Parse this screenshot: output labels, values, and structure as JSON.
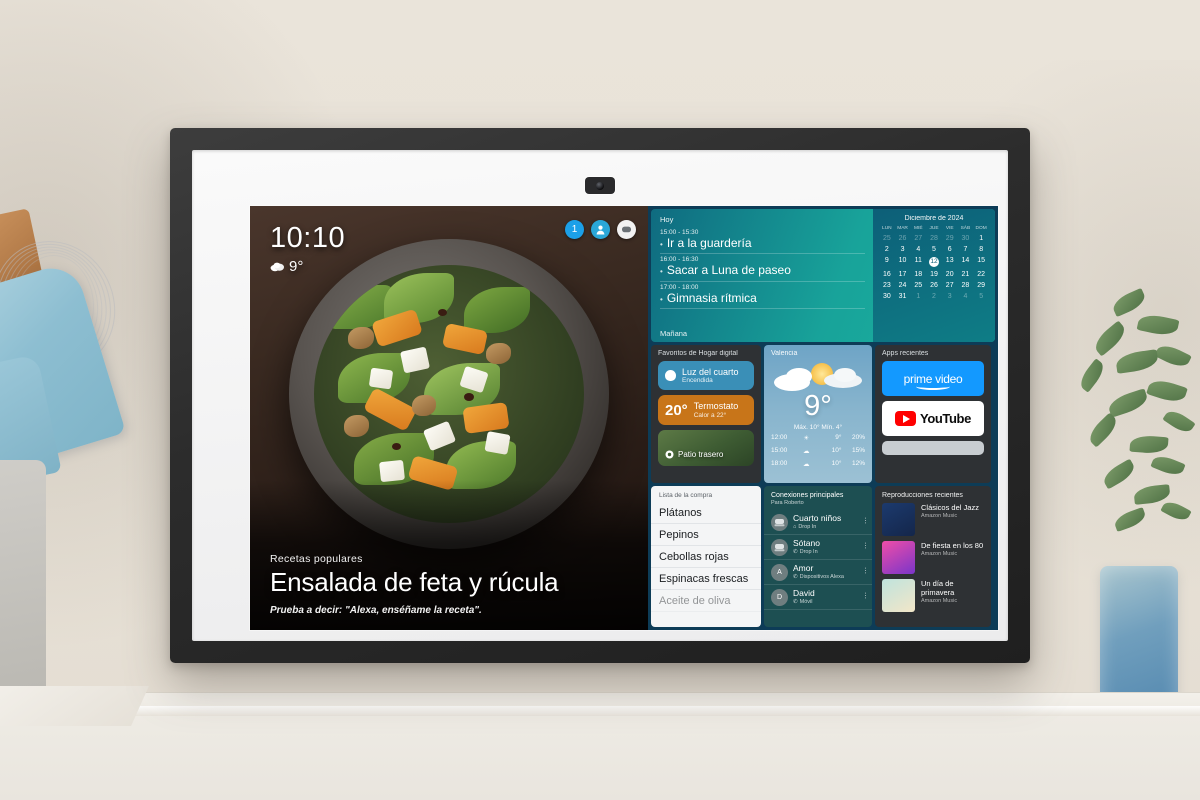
{
  "device": {
    "camera_icon": "camera-icon"
  },
  "screen": {
    "recipe": {
      "clock_time": "10:10",
      "clock_temp": "9°",
      "clock_weather_icon": "cloud-icon",
      "kicker": "Recetas populares",
      "title": "Ensalada de feta y rúcula",
      "prompt": "Prueba a decir: \"Alexa, enséñame la receta\".",
      "status_icons": [
        {
          "name": "notification-badge-icon",
          "glyph": "1",
          "color": "#1ca0e8"
        },
        {
          "name": "account-avatar-icon",
          "glyph": "●",
          "color": "#2aa7d8"
        },
        {
          "name": "message-bubble-icon",
          "glyph": "▬",
          "color": "#f2f2f2"
        }
      ]
    },
    "calendar": {
      "today_label": "Hoy",
      "tomorrow_label": "Mañana",
      "month": "Diciembre de 2024",
      "weekdays": [
        "LUN",
        "MAR",
        "MIÉ",
        "JUE",
        "VIE",
        "SÁB",
        "DOM"
      ],
      "days": [
        {
          "d": "25",
          "mute": true
        },
        {
          "d": "26",
          "mute": true
        },
        {
          "d": "27",
          "mute": true
        },
        {
          "d": "28",
          "mute": true
        },
        {
          "d": "29",
          "mute": true
        },
        {
          "d": "30",
          "mute": true
        },
        {
          "d": "1"
        },
        {
          "d": "2"
        },
        {
          "d": "3"
        },
        {
          "d": "4"
        },
        {
          "d": "5"
        },
        {
          "d": "6"
        },
        {
          "d": "7"
        },
        {
          "d": "8"
        },
        {
          "d": "9"
        },
        {
          "d": "10"
        },
        {
          "d": "11"
        },
        {
          "d": "12",
          "today": true
        },
        {
          "d": "13"
        },
        {
          "d": "14"
        },
        {
          "d": "15"
        },
        {
          "d": "16"
        },
        {
          "d": "17"
        },
        {
          "d": "18"
        },
        {
          "d": "19"
        },
        {
          "d": "20"
        },
        {
          "d": "21"
        },
        {
          "d": "22"
        },
        {
          "d": "23"
        },
        {
          "d": "24"
        },
        {
          "d": "25"
        },
        {
          "d": "26"
        },
        {
          "d": "27"
        },
        {
          "d": "28"
        },
        {
          "d": "29"
        },
        {
          "d": "30"
        },
        {
          "d": "31"
        },
        {
          "d": "1",
          "mute": true
        },
        {
          "d": "2",
          "mute": true
        },
        {
          "d": "3",
          "mute": true
        },
        {
          "d": "4",
          "mute": true
        },
        {
          "d": "5",
          "mute": true
        }
      ],
      "events": [
        {
          "time": "15:00 - 15:30",
          "name": "Ir a la guardería"
        },
        {
          "time": "16:00 - 16:30",
          "name": "Sacar a Luna de paseo"
        },
        {
          "time": "17:00 - 18:00",
          "name": "Gimnasia rítmica"
        }
      ]
    },
    "home_favorites": {
      "title": "Favoritos de Hogar digital",
      "light": {
        "name": "Luz del cuarto",
        "state": "Encendida",
        "icon": "lightbulb-icon"
      },
      "thermostat": {
        "value": "20°",
        "name": "Termostato",
        "state": "Calor a 22°"
      },
      "camera": {
        "name": "Patio trasero",
        "icon": "camera-device-icon"
      }
    },
    "weather": {
      "city": "Valencia",
      "temp": "9°",
      "minmax": "Máx. 10°  Mín. 4°",
      "icon": "sun-behind-cloud-icon",
      "hourly": [
        {
          "time": "12:00",
          "icon": "sun-icon",
          "temp": "9°",
          "precip": "20%"
        },
        {
          "time": "15:00",
          "icon": "cloud-icon",
          "temp": "10°",
          "precip": "15%"
        },
        {
          "time": "18:00",
          "icon": "cloud-icon",
          "temp": "10°",
          "precip": "12%"
        }
      ]
    },
    "apps": {
      "title": "Apps recientes",
      "prime": "prime video",
      "youtube": "YouTube"
    },
    "shopping_list": {
      "title": "Lista de la compra",
      "items": [
        "Plátanos",
        "Pepinos",
        "Cebollas rojas",
        "Espinacas frescas",
        "Aceite de oliva"
      ]
    },
    "connections": {
      "title": "Conexiones principales",
      "subtitle": "Para Roberto",
      "items": [
        {
          "name": "Cuarto niños",
          "sub": "Drop In",
          "initial": "",
          "icon": "device-echo-icon"
        },
        {
          "name": "Sótano",
          "sub": "Drop In",
          "initial": "",
          "icon": "device-echo-icon"
        },
        {
          "name": "Amor",
          "sub": "Dispositivos Alexa",
          "initial": "A",
          "icon": "phone-icon"
        },
        {
          "name": "David",
          "sub": "Móvil",
          "initial": "D",
          "icon": "phone-icon"
        }
      ]
    },
    "music": {
      "title": "Reproducciones recientes",
      "items": [
        {
          "name": "Clásicos del Jazz",
          "source": "Amazon Music"
        },
        {
          "name": "De fiesta en los 80",
          "source": "Amazon Music"
        },
        {
          "name": "Un día de primavera",
          "source": "Amazon Music"
        }
      ]
    }
  }
}
